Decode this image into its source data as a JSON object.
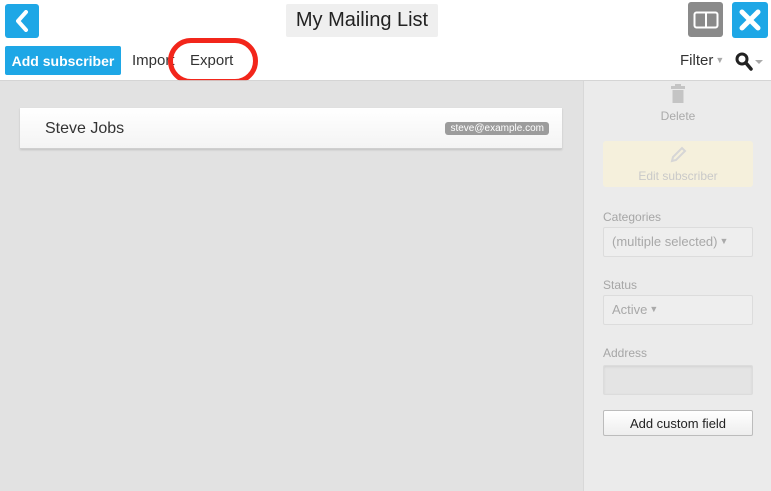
{
  "header": {
    "title": "My Mailing List",
    "back_icon": "chevron-left-icon",
    "split_icon": "split-view-icon",
    "close_icon": "close-icon"
  },
  "toolbar": {
    "add_subscriber_label": "Add subscriber",
    "import_label": "Import",
    "export_label": "Export",
    "filter_label": "Filter",
    "search_icon": "search-icon"
  },
  "subscribers": [
    {
      "name": "Steve Jobs",
      "email": "steve@example.com"
    }
  ],
  "side_panel": {
    "delete_label": "Delete",
    "edit_label": "Edit subscriber",
    "categories_label": "Categories",
    "categories_value": "(multiple selected)",
    "status_label": "Status",
    "status_value": "Active",
    "address_label": "Address",
    "address_value": "",
    "add_custom_field_label": "Add custom field"
  },
  "colors": {
    "accent": "#1ea7e6",
    "highlight": "#f2261b",
    "main_bg": "#e2e2e2",
    "panel_bg": "#ebebeb"
  }
}
